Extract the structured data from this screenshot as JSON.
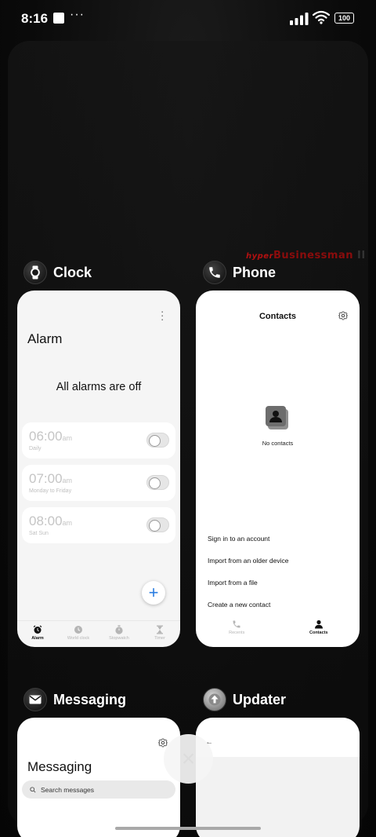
{
  "status_bar": {
    "time": "8:16",
    "more": "···",
    "battery": "100"
  },
  "watermark": {
    "part_a": "hyper",
    "part_b": "Businessman",
    "part_c": "II"
  },
  "apps": [
    {
      "name": "Clock",
      "icon": "watch-icon",
      "screen": {
        "title": "Alarm",
        "empty_message": "All alarms are off",
        "alarms": [
          {
            "time": "06:00",
            "ampm": "am",
            "days": "Daily",
            "enabled": false
          },
          {
            "time": "07:00",
            "ampm": "am",
            "days": "Monday to Friday",
            "enabled": false
          },
          {
            "time": "08:00",
            "ampm": "am",
            "days": "Sat Sun",
            "enabled": false
          }
        ],
        "fab": "+",
        "nav": [
          "Alarm",
          "World clock",
          "Stopwatch",
          "Timer"
        ],
        "active_nav": "Alarm"
      }
    },
    {
      "name": "Phone",
      "icon": "phone-icon",
      "screen": {
        "title": "Contacts",
        "empty_message": "No contacts",
        "actions": [
          "Sign in to an account",
          "Import from an older device",
          "Import from a file",
          "Create a new contact"
        ],
        "nav": [
          "Recents",
          "Contacts"
        ],
        "active_nav": "Contacts"
      }
    },
    {
      "name": "Messaging",
      "icon": "envelope-icon",
      "screen": {
        "title": "Messaging",
        "search_placeholder": "Search messages"
      }
    },
    {
      "name": "Updater",
      "icon": "upload-icon",
      "screen": {
        "back": "←"
      }
    }
  ],
  "clear_all": "×",
  "colors": {
    "accent": "#2a7de1",
    "background": "#080808",
    "card": "#ffffff"
  }
}
